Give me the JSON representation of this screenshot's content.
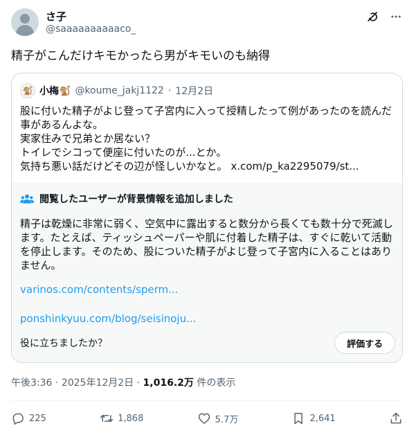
{
  "author": {
    "name": "さ子",
    "handle": "@saaaaaaaaaaco_"
  },
  "post_text": "精子がこんだけキモかったら男がキモいのも納得",
  "quote": {
    "name": "小梅",
    "name_emoji": "🐒",
    "handle": "@koume_jakj1122",
    "separator": "·",
    "date": "12月2日",
    "lines": [
      "股に付いた精子がよじ登って子宮内に入って授精したって例があったのを読んだ",
      "事があるんよな。",
      "実家住みで兄弟とか居ない？",
      "トイレでシコって便座に付いたのが...とか。"
    ],
    "last_line": "気持ち悪い話だけどその辺が怪しいかなと。",
    "link": "x.com/p_ka2295079/st..."
  },
  "community_note": {
    "title": "閲覧したユーザーが背景情報を追加しました",
    "lines": [
      "精子は乾燥に非常に弱く、空気中に露出すると数分から長くても数十分で死滅し",
      "ます。たとえば、ティッシュペーパーや肌に付着した精子は、すぐに乾いて活動",
      "を停止します。そのため、股についた精子がよじ登って子宮内に入ることはあり",
      "ません。"
    ],
    "links": [
      "varinos.com/contents/sperm...",
      "ponshinkyuu.com/blog/seisinoju..."
    ],
    "helpful_question": "役に立ちましたか？",
    "rate_button": "評価する"
  },
  "meta": {
    "time": "午後3:36",
    "dot": "·",
    "date": "2025年12月2日",
    "views_count": "1,016.2万",
    "views_label": "件の表示"
  },
  "actions": {
    "replies": "225",
    "reposts": "1,868",
    "likes": "5.7万",
    "bookmarks": "2,641"
  },
  "colors": {
    "text": "#0f1419",
    "secondary": "#536471",
    "link": "#1d9bf0",
    "border": "#cfd9de",
    "note_bg": "#f7f9f9"
  },
  "icons": [
    "grok-icon",
    "more-icon",
    "reply-icon",
    "repost-icon",
    "like-icon",
    "bookmark-icon",
    "share-icon",
    "people-icon"
  ]
}
